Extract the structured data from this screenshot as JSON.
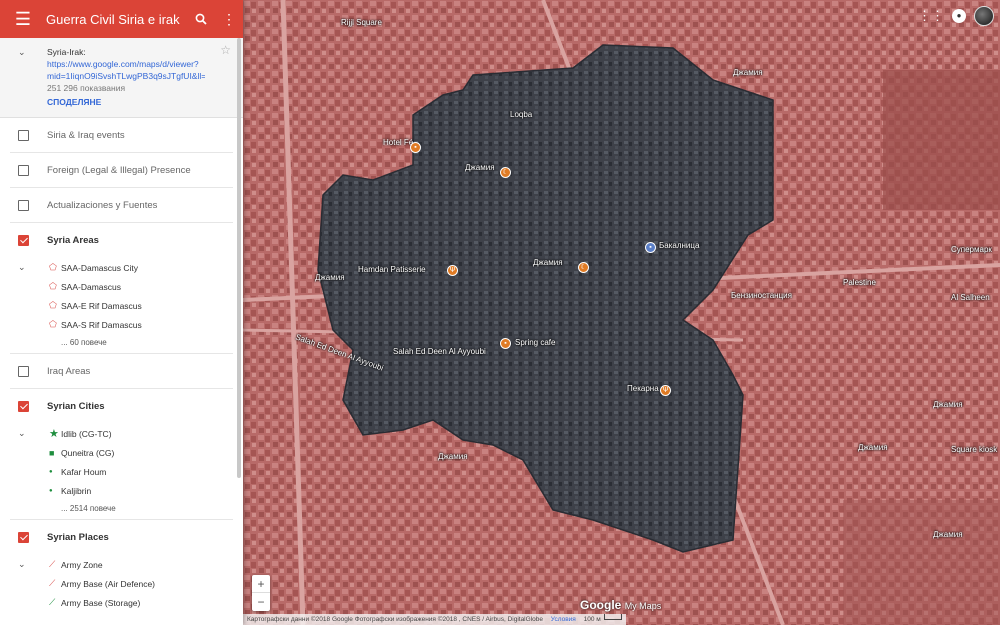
{
  "header": {
    "title": "Guerra Civil Siria e irak",
    "menu_icon": "menu-icon",
    "search_icon": "search-icon",
    "more_icon": "more-vert-icon",
    "color": "#db4437"
  },
  "info": {
    "name": "Syria-Irak:",
    "link_line1": "https://www.google.com/maps/d/viewer?",
    "link_line2": "mid=1IiqnO9iSvshTLwgPB3q9sJTgfUI&ll=3",
    "views": "251 296 показвания",
    "share_label": "СПОДЕЛЯНЕ"
  },
  "layers": [
    {
      "name": "Siria & Iraq events",
      "checked": false
    },
    {
      "name": "Foreign (Legal & Illegal) Presence",
      "checked": false
    },
    {
      "name": "Actualizaciones y Fuentes",
      "checked": false
    },
    {
      "name": "Syria Areas",
      "checked": true,
      "items": [
        "SAA-Damascus City",
        "SAA-Damascus",
        "SAA-E Rif Damascus",
        "SAA-S Rif Damascus"
      ],
      "more": "... 60 повече"
    },
    {
      "name": "Iraq Areas",
      "checked": false
    },
    {
      "name": "Syrian Cities",
      "checked": true,
      "items": [
        "Idlib (CG-TC)",
        "Quneitra (CG)",
        "Kafar Houm",
        "Kaljibrin"
      ],
      "more": "... 2514 повече"
    },
    {
      "name": "Syrian Places",
      "checked": true,
      "items": [
        "Army Zone",
        "Army Base (Air Defence)",
        "Army Base (Storage)"
      ]
    }
  ],
  "map": {
    "labels": {
      "rijjl_square": "Rijjl Square",
      "hotel_fe": "Hotel Fé",
      "loqba": "Loqba",
      "mosque1": "Джамия",
      "mosque2": "Джамия",
      "mosque3": "Джамия",
      "mosque4": "Джамия",
      "mosque5": "Джамия",
      "mosque6": "Джамия",
      "mosque7": "Джамия",
      "mosque8": "Джамия",
      "hamdan": "Hamdan Patisserie",
      "bakery": "Бакалница",
      "gas": "Бензиностанция",
      "palestine": "Palestine",
      "salah": "Salah Ed Deen Al Ayyoubi",
      "salah2": "Salah Ed Deen Al Ayyoubi",
      "spring": "Spring cafe",
      "pekarna": "Пекарна",
      "supermarket": "Супермарк",
      "alsalheen": "Al Salheen",
      "square_kiosk": "Square kiosk"
    },
    "zoom_in": "+",
    "zoom_out": "−",
    "logo": "Google",
    "logo_suffix": "My Maps",
    "attribution": "Картографски данни ©2018 Google Фотографски изображения ©2018 , CNES / Airbus, DigitalGlobe",
    "terms": "Условия",
    "scale": "100 м",
    "area_color": "#c05a5a",
    "overlay_color": "#3a3d45"
  },
  "topbar": {
    "apps_icon": "apps-grid-icon",
    "bell_icon": "notifications-icon",
    "avatar_icon": "avatar"
  }
}
